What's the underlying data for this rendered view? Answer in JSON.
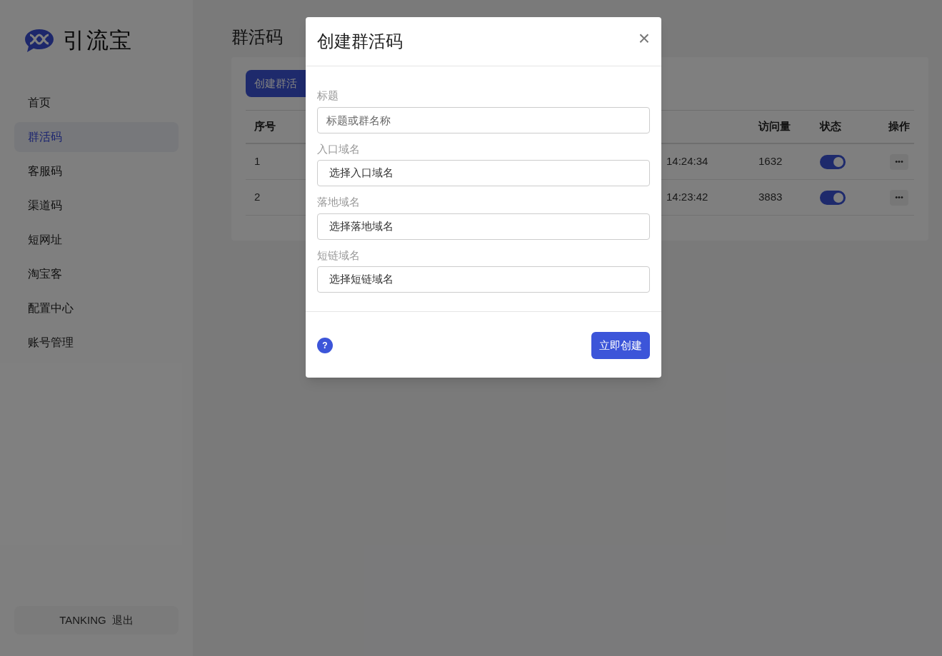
{
  "brand": {
    "name": "引流宝"
  },
  "sidebar": {
    "items": [
      {
        "label": "首页",
        "selected": false
      },
      {
        "label": "群活码",
        "selected": true
      },
      {
        "label": "客服码",
        "selected": false
      },
      {
        "label": "渠道码",
        "selected": false
      },
      {
        "label": "短网址",
        "selected": false
      },
      {
        "label": "淘宝客",
        "selected": false
      },
      {
        "label": "配置中心",
        "selected": false
      },
      {
        "label": "账号管理",
        "selected": false
      }
    ],
    "user": {
      "name": "TANKING",
      "logout": "退出"
    }
  },
  "page": {
    "title": "群活码",
    "create_button": "创建群活"
  },
  "table": {
    "columns": [
      "序号",
      "访问量",
      "状态",
      "操作"
    ],
    "rows": [
      {
        "index": "1",
        "time": "14:24:34",
        "visits": "1632",
        "on": true,
        "action": "•••"
      },
      {
        "index": "2",
        "time": "14:23:42",
        "visits": "3883",
        "on": true,
        "action": "•••"
      }
    ]
  },
  "dialog": {
    "title": "创建群活码",
    "close": "×",
    "fields": [
      {
        "kind": "input",
        "label": "标题",
        "placeholder": "标题或群名称"
      },
      {
        "kind": "select",
        "label": "入口域名",
        "value": "选择入口域名"
      },
      {
        "kind": "select",
        "label": "落地域名",
        "value": "选择落地域名"
      },
      {
        "kind": "select",
        "label": "短链域名",
        "value": "选择短链域名"
      }
    ],
    "help": "?",
    "submit": "立即创建"
  }
}
